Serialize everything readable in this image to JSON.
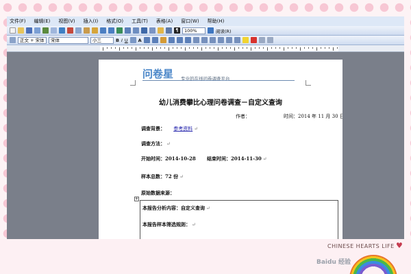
{
  "menu": {
    "items": [
      "文件(F)",
      "编辑(E)",
      "视图(V)",
      "插入(I)",
      "格式(O)",
      "工具(T)",
      "表格(A)",
      "窗口(W)",
      "帮助(H)"
    ]
  },
  "toolbar": {
    "zoom": "100%",
    "read_button": "阅读(R)",
    "style": "正文 + 宋体",
    "font": "宋体",
    "size": "小三"
  },
  "document": {
    "logo_text": "问卷星",
    "logo_tagline": "专业的在线问卷调查平台",
    "title": "幼儿消费攀比心理问卷调查－自定义查询",
    "author_label": "作者：",
    "time_text": "时间：2014 年 11 月 30 日",
    "background_label": "调查背景：",
    "background_link": "参考资料",
    "method_label": "调查方法：",
    "start_label": "开始时间：",
    "start_value": "2014-10-28",
    "end_label": "结束时间：",
    "end_value": "2014-11-30",
    "sample_label": "样本总数：",
    "sample_value": "72 份",
    "source_label": "原始数据来源：",
    "analysis_text": "本报告分析内容：自定义查询",
    "rule_label": "本报告样本筛选规则：",
    "para_mark": "↵"
  },
  "watermark": {
    "brand": "CHINESE HEARTS LIFE",
    "site": "Baidu 经验"
  },
  "colors": {
    "logo": "#4a86c8",
    "link": "#1a1aa8",
    "frame_dot": "#f7c7d4"
  }
}
